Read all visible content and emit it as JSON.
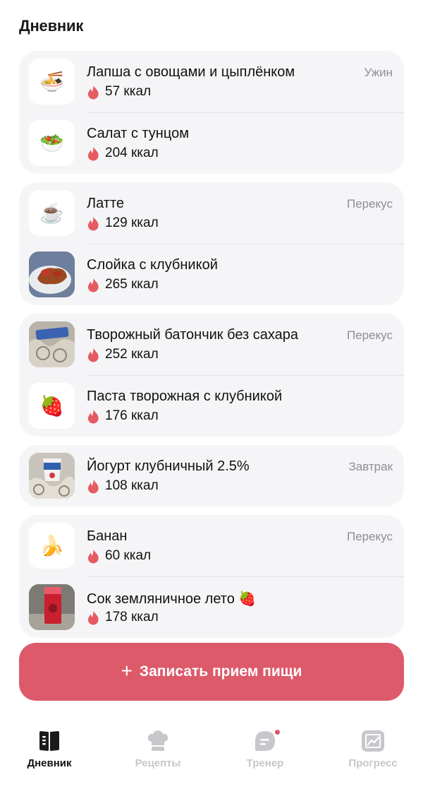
{
  "page": {
    "title": "Дневник"
  },
  "groups": [
    {
      "items": [
        {
          "name": "Лапша с овощами и цыплёнком",
          "kcal": "57 ккал",
          "meal_type": "Ужин",
          "icon": "noodle-bowl-icon",
          "emoji": "🍜",
          "photo": false
        },
        {
          "name": "Салат с тунцом",
          "kcal": "204 ккал",
          "meal_type": "",
          "icon": "salad-icon",
          "emoji": "🥗",
          "photo": false
        }
      ]
    },
    {
      "items": [
        {
          "name": "Латте",
          "kcal": "129 ккал",
          "meal_type": "Перекус",
          "icon": "coffee-cup-icon",
          "emoji": "☕",
          "photo": false
        },
        {
          "name": "Слойка с клубникой",
          "kcal": "265 ккал",
          "meal_type": "",
          "icon": "pastry-photo",
          "emoji": "",
          "photo": true
        }
      ]
    },
    {
      "items": [
        {
          "name": "Творожный батончик без сахара",
          "kcal": "252 ккал",
          "meal_type": "Перекус",
          "icon": "curd-bar-photo",
          "emoji": "",
          "photo": true
        },
        {
          "name": "Паста творожная с клубникой",
          "kcal": "176 ккал",
          "meal_type": "",
          "icon": "strawberry-icon",
          "emoji": "🍓",
          "photo": false
        }
      ]
    },
    {
      "items": [
        {
          "name": "Йогурт клубничный 2.5%",
          "kcal": "108 ккал",
          "meal_type": "Завтрак",
          "icon": "yogurt-photo",
          "emoji": "",
          "photo": true
        }
      ]
    },
    {
      "items": [
        {
          "name": "Банан",
          "kcal": "60 ккал",
          "meal_type": "Перекус",
          "icon": "banana-icon",
          "emoji": "🍌",
          "photo": false
        },
        {
          "name": "Сок земляничное лето 🍓",
          "kcal": "178 ккал",
          "meal_type": "",
          "icon": "juice-photo",
          "emoji": "",
          "photo": true
        }
      ]
    }
  ],
  "add_button": {
    "label": "Записать прием пищи",
    "icon": "plus-icon"
  },
  "tabbar": {
    "tabs": [
      {
        "id": "diary",
        "label": "Дневник",
        "icon": "book-icon",
        "active": true
      },
      {
        "id": "recipes",
        "label": "Рецепты",
        "icon": "chef-hat-icon",
        "active": false
      },
      {
        "id": "coach",
        "label": "Тренер",
        "icon": "chat-bubble-icon",
        "active": false,
        "badge": true
      },
      {
        "id": "progress",
        "label": "Прогресс",
        "icon": "chart-icon",
        "active": false
      }
    ]
  },
  "colors": {
    "accent": "#dd5a6b",
    "flame": "#e65b62",
    "card_bg": "#f5f5f7",
    "muted_text": "#8e8e93",
    "inactive_tab": "#c7c7cc"
  }
}
